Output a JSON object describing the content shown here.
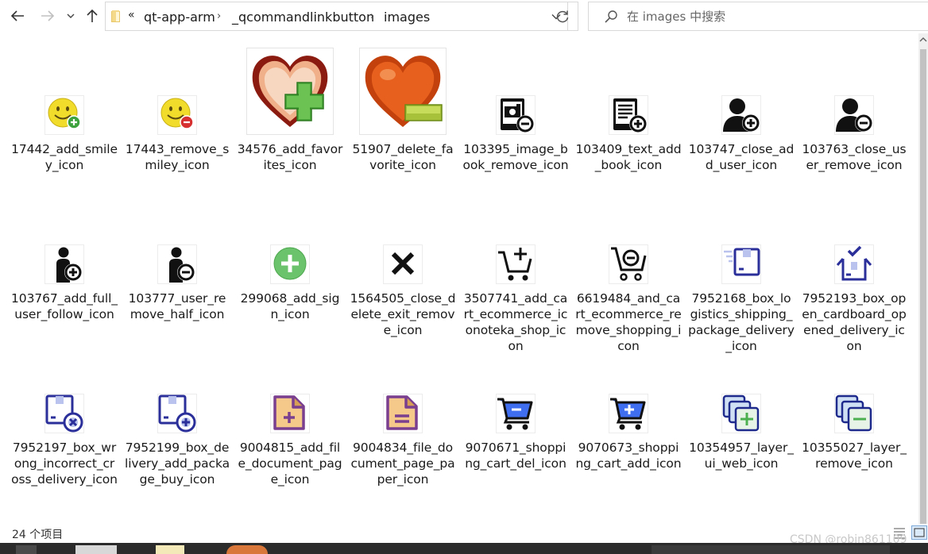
{
  "toolbar": {
    "back_icon": "arrow-left-icon",
    "forward_icon": "arrow-right-icon",
    "history_icon": "chevron-down-icon",
    "up_icon": "arrow-up-icon",
    "refresh_icon": "refresh-icon"
  },
  "address": {
    "overflow": "«",
    "crumbs": [
      "qt-app-arm",
      "_qcommandlinkbutton",
      "images"
    ],
    "separator": "›"
  },
  "search": {
    "placeholder": "在 images 中搜索"
  },
  "files": [
    {
      "name": "17442_add_smiley_icon",
      "icon": "smiley-add-icon"
    },
    {
      "name": "17443_remove_smiley_icon",
      "icon": "smiley-remove-icon"
    },
    {
      "name": "34576_add_favorites_icon",
      "icon": "heart-add-icon"
    },
    {
      "name": "51907_delete_favorite_icon",
      "icon": "heart-remove-icon"
    },
    {
      "name": "103395_image_book_remove_icon",
      "icon": "image-book-remove-icon"
    },
    {
      "name": "103409_text_add_book_icon",
      "icon": "text-book-add-icon"
    },
    {
      "name": "103747_close_add_user_icon",
      "icon": "user-add-icon"
    },
    {
      "name": "103763_close_user_remove_icon",
      "icon": "user-remove-icon"
    },
    {
      "name": "103767_add_full_user_follow_icon",
      "icon": "user-follow-add-icon"
    },
    {
      "name": "103777_user_remove_half_icon",
      "icon": "user-half-remove-icon"
    },
    {
      "name": "299068_add_sign_icon",
      "icon": "plus-circle-icon"
    },
    {
      "name": "1564505_close_delete_exit_remove_icon",
      "icon": "close-x-icon"
    },
    {
      "name": "3507741_add_cart_ecommerce_iconoteka_shop_icon",
      "icon": "cart-add-icon"
    },
    {
      "name": "6619484_and_cart_ecommerce_remove_shopping_icon",
      "icon": "cart-remove-icon"
    },
    {
      "name": "7952168_box_logistics_shipping_package_delivery_icon",
      "icon": "box-delivery-icon"
    },
    {
      "name": "7952193_box_open_cardboard_opened_delivery_icon",
      "icon": "box-open-icon"
    },
    {
      "name": "7952197_box_wrong_incorrect_cross_delivery_icon",
      "icon": "box-cross-icon"
    },
    {
      "name": "7952199_box_delivery_add_package_buy_icon",
      "icon": "box-add-icon"
    },
    {
      "name": "9004815_add_file_document_page_icon",
      "icon": "file-add-icon"
    },
    {
      "name": "9004834_file_document_page_paper_icon",
      "icon": "file-remove-icon"
    },
    {
      "name": "9070671_shopping_cart_del_icon",
      "icon": "cart-del-blue-icon"
    },
    {
      "name": "9070673_shopping_cart_add_icon",
      "icon": "cart-add-blue-icon"
    },
    {
      "name": "10354957_layer_ui_web_icon",
      "icon": "layers-add-icon"
    },
    {
      "name": "10355027_layer_remove_icon",
      "icon": "layers-remove-icon"
    }
  ],
  "status": {
    "count_text": "24 个项目"
  },
  "watermark": "CSDN @robin861109",
  "colors": {
    "selection_blue": "#0078d7",
    "green_plus": "#5bb85b",
    "purple": "#7a3f8f",
    "navy": "#1e2a8c"
  }
}
